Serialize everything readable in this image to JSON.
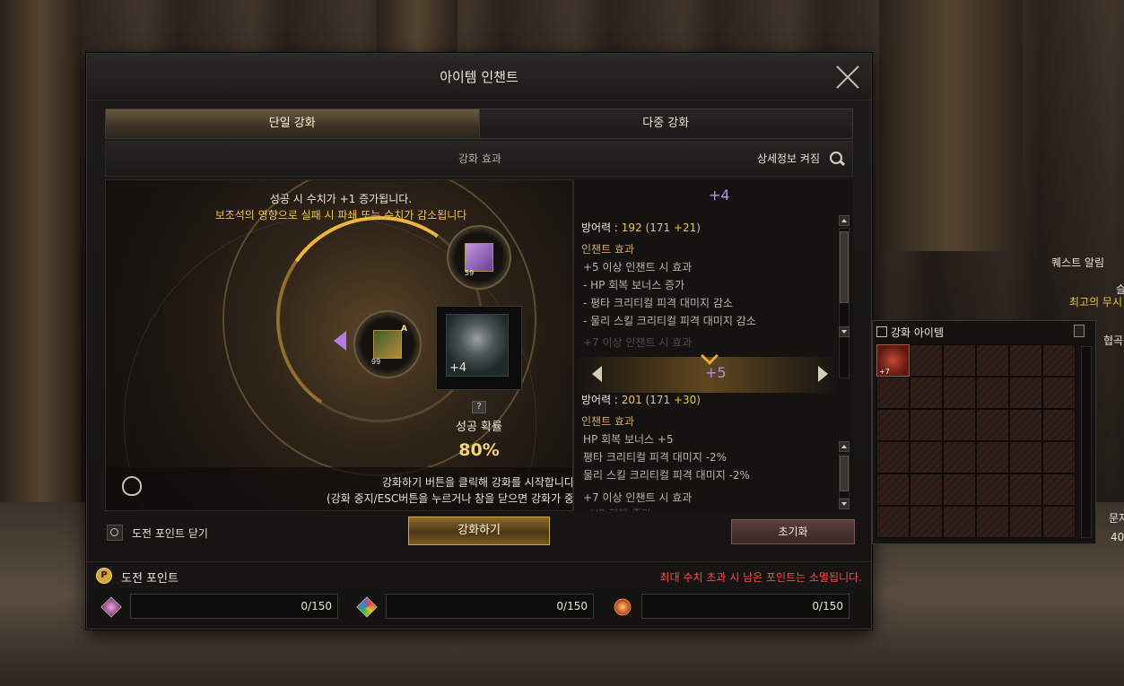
{
  "window": {
    "title": "아이템 인챈트",
    "tabs": [
      {
        "label": "단일 강화",
        "active": true
      },
      {
        "label": "다중 강화",
        "active": false
      }
    ],
    "effect_header": "강화 효과",
    "detail_toggle": "상세정보 켜짐"
  },
  "enchant": {
    "success_text": "성공 시 수치가 +1 증가됩니다.",
    "warning_text": "보조석의 영향으로 실패 시 파쇄 또는 수치가 감소됩니다",
    "support_item_level": "59",
    "material_item_level": "99",
    "material_grade": "A",
    "main_item_level": "+4",
    "help_symbol": "?",
    "rate_label": "성공 확률",
    "rate_value": "80%",
    "hint_line1": "강화하기 버튼을 클릭해 강화를 시작합니다",
    "hint_line2": "(강화 중지/ESC버튼을 누르거나 창을 닫으면 강화가 중"
  },
  "stats": {
    "current": {
      "level": "+4",
      "defense_label": "방어력 : ",
      "defense_value": "192",
      "defense_base": "(171 ",
      "defense_bonus": "+21",
      "defense_close": ")",
      "effects_head": "인챈트 효과",
      "effects": [
        "+5 이상 인챈트 시 효과",
        "- HP 회복 보너스 증가",
        "- 평타 크리티컬 피격 대미지 감소",
        "- 물리 스킬 크리티컬 피격 대미지 감소",
        "+7 이상 인챈트 시 효과"
      ]
    },
    "next": {
      "level": "+5",
      "defense_label": "방어력 : ",
      "defense_value": "201",
      "defense_base": "(171 ",
      "defense_bonus": "+30",
      "defense_close": ")",
      "effects_head": "인챈트 효과",
      "effects": [
        "HP 회복 보너스 +5",
        "평타 크리티컬 피격 대미지 -2%",
        "물리 스킬 크리티컬 피격 대미지 -2%",
        "+7 이상 인챈트 시 효과",
        "- HP 회복 증가"
      ]
    }
  },
  "controls": {
    "challenge_toggle_label": "도전 포인트 닫기",
    "enchant_button": "강화하기",
    "reset_button": "초기화"
  },
  "points": {
    "icon_letter": "P",
    "title": "도전 포인트",
    "warning": "최대 수치 초과 시 남은 포인트는 소멸됩니다.",
    "cells": [
      {
        "value": "0/150",
        "icon": "pink-gem-icon"
      },
      {
        "value": "0/150",
        "icon": "multicolor-gem-icon"
      },
      {
        "value": "0/150",
        "icon": "fire-emblem-icon"
      }
    ]
  },
  "hud": {
    "quest_alert": "퀘스트 알림",
    "quest_sub": "최고의 무시",
    "inventory_title": "강화 아이템",
    "inventory_item_level": "+7",
    "side_fragments": [
      "협곡",
      "문자",
      "40",
      "슬"
    ]
  },
  "colors": {
    "accent_gold": "#f1c346",
    "purple_level": "#b592ec",
    "warning_red": "#f0504a"
  }
}
